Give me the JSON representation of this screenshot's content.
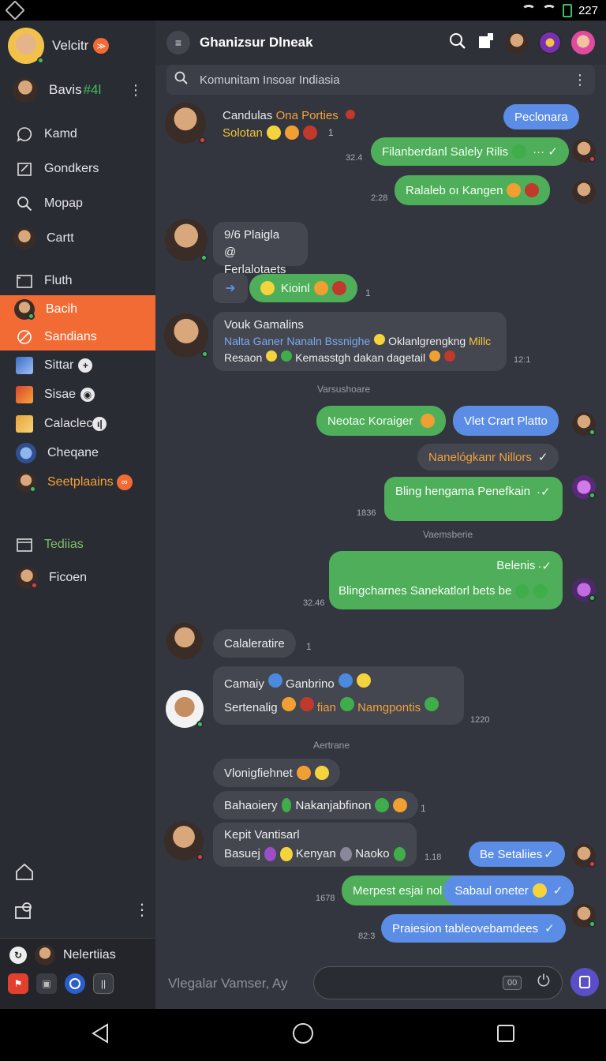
{
  "status": {
    "time": "227"
  },
  "sidebar": {
    "profile": {
      "name": "Velcitr",
      "badge": "≫"
    },
    "user2": {
      "name": "Bavis",
      "tag": "#4l"
    },
    "items": [
      {
        "label": "Kamd",
        "icon": "chat-bubble-icon"
      },
      {
        "label": "Gondkers",
        "icon": "edit-square-icon"
      },
      {
        "label": "Mopap",
        "icon": "search-icon"
      },
      {
        "label": "Cartt",
        "icon": "avatar"
      },
      {
        "label": "Fluth",
        "icon": "window-icon"
      },
      {
        "label": "Bacih",
        "icon": "avatar"
      },
      {
        "label": "Sandians",
        "icon": "palette-icon"
      },
      {
        "label": "Sittar",
        "icon": "thumb",
        "badge": "+"
      },
      {
        "label": "Sisae",
        "icon": "thumb",
        "badge": "◉"
      },
      {
        "label": "Calaclec",
        "icon": "thumb",
        "badge": "ı|"
      },
      {
        "label": "Cheqane",
        "icon": "avatar"
      },
      {
        "label": "Seetplaains",
        "icon": "avatar",
        "badge": "∞"
      },
      {
        "label": "Tediias",
        "icon": "window-icon"
      },
      {
        "label": "Ficoen",
        "icon": "avatar"
      }
    ],
    "footer": {
      "name": "Nelertiias"
    }
  },
  "header": {
    "title": "Ghanizsur Dlneak",
    "search_placeholder": "Komunitam Insoar Indiasia"
  },
  "messages": {
    "m1_name": "Candulas",
    "m1_name2": "Ona Porties",
    "m1_sub": "Solotan",
    "m1_count": "1",
    "pill_peclonara": "Peclonara",
    "ts_324": "32.4",
    "msg_filanber": "Filanberdanl Salely Rilis",
    "ts_228": "2:28",
    "msg_ralaleb": "Ralaleb oı Kangen",
    "m2_name": "9/6 Plaigla",
    "m2_sub": "@ Ferlalotaets",
    "m2_react": "Kioinl",
    "m2_count": "1",
    "m3_name": "Vouk Gamalins",
    "m3_line1a": "Nalta Ganer Nanaln Bssnighe",
    "m3_line1b": "Oklanlgrengkng",
    "m3_line1c": "Millc",
    "m3_line2a": "Resaon",
    "m3_line2b": "Kemasstgh dakan dagetail",
    "ts_121": "12:1",
    "label_vars": "Varsushoare",
    "msg_neotac": "Neotac Koraiger",
    "msg_vlet": "Vlet Crart Platto",
    "msg_nanel": "Nanelógkanr Nillors",
    "msg_bling": "Bling hengama Penefkain",
    "ts_1836": "1836",
    "label_vaem": "Vaemsberie",
    "msg_belenis": "Belenis",
    "msg_bling2": "Blingcharnes Sanekatlorl bets be",
    "ts_3246": "32.46",
    "m4_name": "Calaleratire",
    "m4_count": "1",
    "m5_line1": "Camaiy",
    "m5_line1b": "Ganbrino",
    "m5_line2a": "Sertenalig",
    "m5_line2b": "fian",
    "m5_line2c": "Namgpontis",
    "ts_1220": "1220",
    "label_aert": "Aertrane",
    "msg_vlonig": "Vlonigfiehnet",
    "msg_bahaoiery": "Bahaoiery",
    "msg_nakan": "Nakanjabfinon",
    "m6_count": "1",
    "m6_name": "Kepit Vantisarl",
    "m6_line": "Basuej",
    "m6_line_b": "Kenyan",
    "m6_line_c": "Naoko",
    "ts_118": "1.18",
    "msg_besetal": "Be Setaliies",
    "msg_merpest": "Merpest esjai nol",
    "msg_sabaul": "Sabaul oneter",
    "ts_1678": "1678",
    "msg_praiesion": "Praiesion tableovebamdees",
    "ts_823": "82:3"
  },
  "composer": {
    "placeholder": "Vlegalar Vamser, Ay",
    "chip": "00"
  }
}
